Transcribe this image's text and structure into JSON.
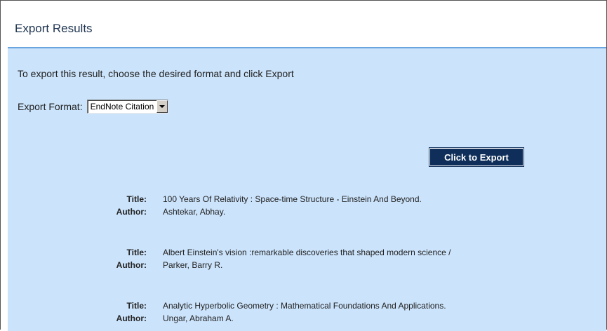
{
  "header": {
    "title": "Export Results"
  },
  "intro_text": "To export this result, choose the desired format and click Export",
  "format": {
    "label": "Export Format:",
    "selected": "EndNote Citation"
  },
  "export_button": {
    "label": "Click to Export"
  },
  "labels": {
    "title": "Title:",
    "author": "Author:"
  },
  "results": [
    {
      "title": "100 Years Of Relativity : Space-time Structure - Einstein And Beyond.",
      "author": "Ashtekar, Abhay."
    },
    {
      "title": "Albert Einstein's vision :remarkable discoveries that shaped modern science /",
      "author": "Parker, Barry R."
    },
    {
      "title": "Analytic Hyperbolic Geometry : Mathematical Foundations And Applications.",
      "author": "Ungar, Abraham A."
    }
  ],
  "colors": {
    "panel_bg": "#cbe3fb",
    "panel_border": "#6aa5df",
    "button_bg": "#0f2f5a",
    "title_text": "#1f3550"
  }
}
